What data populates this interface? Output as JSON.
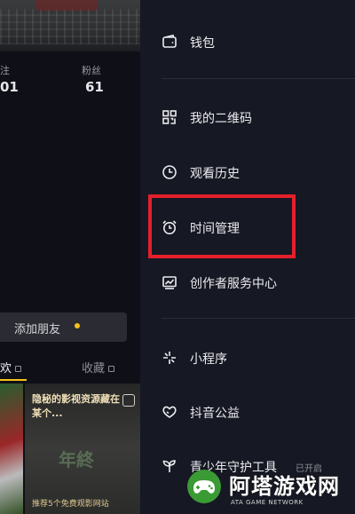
{
  "profile": {
    "stats": [
      {
        "label": "注",
        "value": "01"
      },
      {
        "label": "粉丝",
        "value": "61"
      }
    ],
    "add_friend_label": "添加朋友",
    "tabs": [
      {
        "label": "欢"
      },
      {
        "label": "收藏"
      }
    ],
    "thumbnail": {
      "title": "隐秘的影视资源藏在某个...",
      "overlay": "年終",
      "footer": "推荐5个免费观影网站"
    }
  },
  "drawer": {
    "items": [
      {
        "label": "钱包",
        "icon": "wallet-icon"
      },
      {
        "label": "我的二维码",
        "icon": "qr-code-icon"
      },
      {
        "label": "观看历史",
        "icon": "clock-icon"
      },
      {
        "label": "时间管理",
        "icon": "alarm-clock-icon",
        "highlighted": true
      },
      {
        "label": "创作者服务中心",
        "icon": "chart-icon"
      },
      {
        "label": "小程序",
        "icon": "mini-program-icon"
      },
      {
        "label": "抖音公益",
        "icon": "heart-hands-icon"
      },
      {
        "label": "青少年守护工具",
        "icon": "sprout-icon",
        "status": "已开启"
      }
    ]
  },
  "watermark": {
    "title": "阿塔游戏网",
    "subtitle": "ATA GAME NETWORK"
  },
  "colors": {
    "drawer_bg": "#161823",
    "highlight_border": "#e3202b",
    "accent_yellow": "#f8c21c"
  }
}
